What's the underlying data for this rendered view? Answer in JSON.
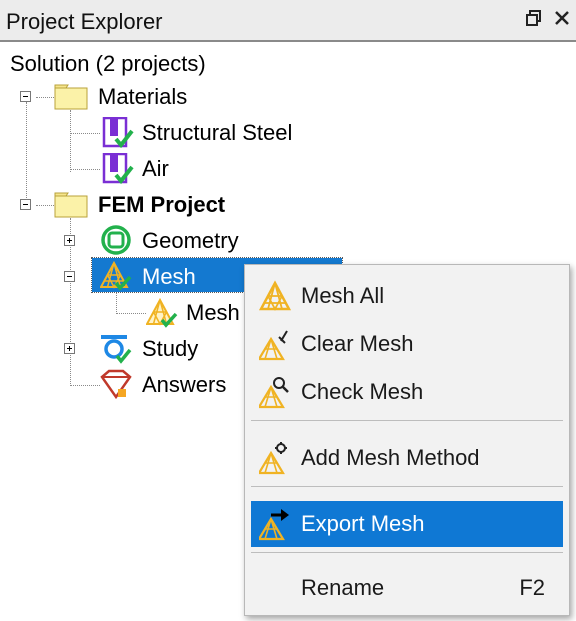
{
  "window": {
    "title": "Project Explorer"
  },
  "tree": {
    "root_label": "Solution (2 projects)",
    "materials": {
      "label": "Materials",
      "children": [
        "Structural Steel",
        "Air"
      ]
    },
    "fem_project": {
      "label": "FEM Project",
      "geometry": "Geometry",
      "mesh": "Mesh",
      "mesh_child": "Mesh",
      "study": "Study",
      "answers": "Answers"
    }
  },
  "context_menu": {
    "items": [
      {
        "label": "Mesh All",
        "icon": "mesh-all-icon"
      },
      {
        "label": "Clear Mesh",
        "icon": "clear-mesh-icon"
      },
      {
        "label": "Check Mesh",
        "icon": "check-mesh-icon"
      },
      {
        "label": "Add Mesh Method",
        "icon": "add-mesh-method-icon"
      },
      {
        "label": "Export Mesh",
        "icon": "export-mesh-icon",
        "highlighted": true
      },
      {
        "label": "Rename",
        "shortcut": "F2"
      }
    ]
  },
  "colors": {
    "selection": "#1479d0",
    "menu_highlight": "#0f78d4",
    "mesh_icon": "#f0b323",
    "check_green": "#22b14c",
    "material_purple": "#7a2fd4"
  }
}
